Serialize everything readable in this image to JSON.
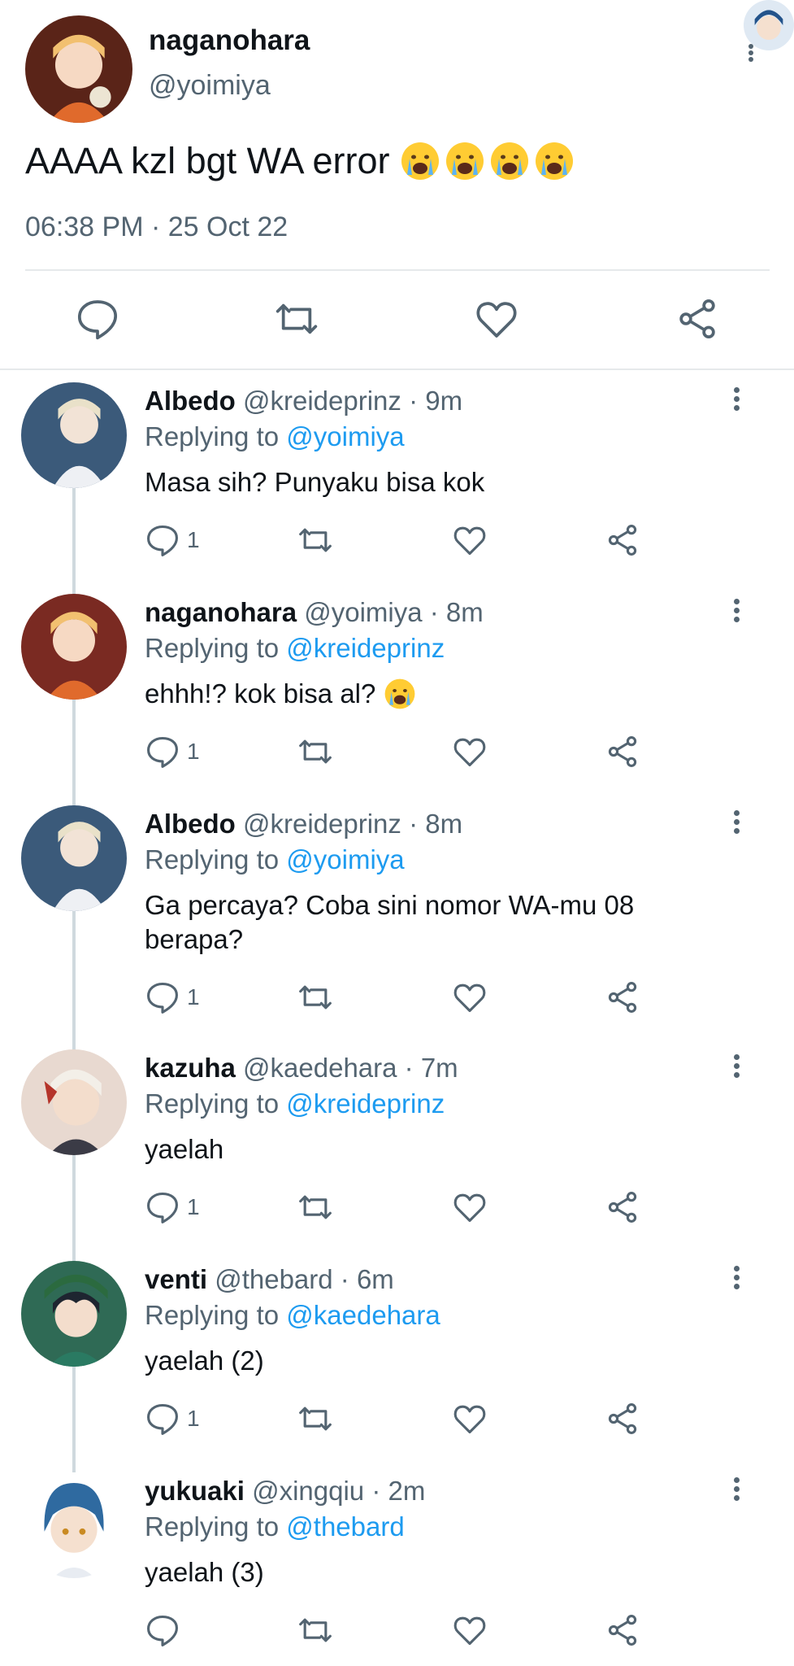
{
  "main_tweet": {
    "author_name": "naganohara",
    "author_handle": "@yoimiya",
    "text": "AAAA kzl bgt WA error",
    "emojis": [
      "crying-face-emoji",
      "crying-face-emoji",
      "crying-face-emoji",
      "crying-face-emoji"
    ],
    "timestamp": "06:38 PM · 25 Oct 22",
    "actions": [
      "reply-icon",
      "retweet-icon",
      "like-icon",
      "share-icon"
    ]
  },
  "replies": [
    {
      "name": "Albedo",
      "handle": "@kreideprinz · 9m",
      "replying_prefix": "Replying to",
      "replying_to": "@yoimiya",
      "text": "Masa sih? Punyaku bisa kok",
      "reply_count": "1",
      "avatar_color": "#3b5a7a"
    },
    {
      "name": "naganohara",
      "handle": "@yoimiya · 8m",
      "replying_prefix": "Replying to",
      "replying_to": "@kreideprinz",
      "text": "ehhh!? kok bisa al?",
      "reply_count": "1",
      "avatar_color": "#7a2a22"
    },
    {
      "name": "Albedo",
      "handle": "@kreideprinz · 8m",
      "replying_prefix": "Replying to",
      "replying_to": "@yoimiya",
      "text": "Ga percaya? Coba sini nomor WA-mu 08 berapa?",
      "reply_count": "1",
      "avatar_color": "#3b5a7a"
    },
    {
      "name": "kazuha",
      "handle": "@kaedehara · 7m",
      "replying_prefix": "Replying to",
      "replying_to": "@kreideprinz",
      "text": "yaelah",
      "reply_count": "1",
      "avatar_color": "#c9a08a"
    },
    {
      "name": "venti",
      "handle": "@thebard · 6m",
      "replying_prefix": "Replying to",
      "replying_to": "@kaedehara",
      "text": "yaelah (2)",
      "reply_count": "1",
      "avatar_color": "#2f6a55"
    },
    {
      "name": "yukuaki",
      "handle": "@xingqiu · 2m",
      "replying_prefix": "Replying to",
      "replying_to": "@thebard",
      "text": "yaelah (3)",
      "reply_count": "",
      "avatar_color": "#2f6aa0"
    }
  ],
  "colors": {
    "text": "#0f1419",
    "secondary": "#536471",
    "mention": "#1d9bf0",
    "divider": "#e6e9eb",
    "thread_line": "#cfd9de"
  }
}
